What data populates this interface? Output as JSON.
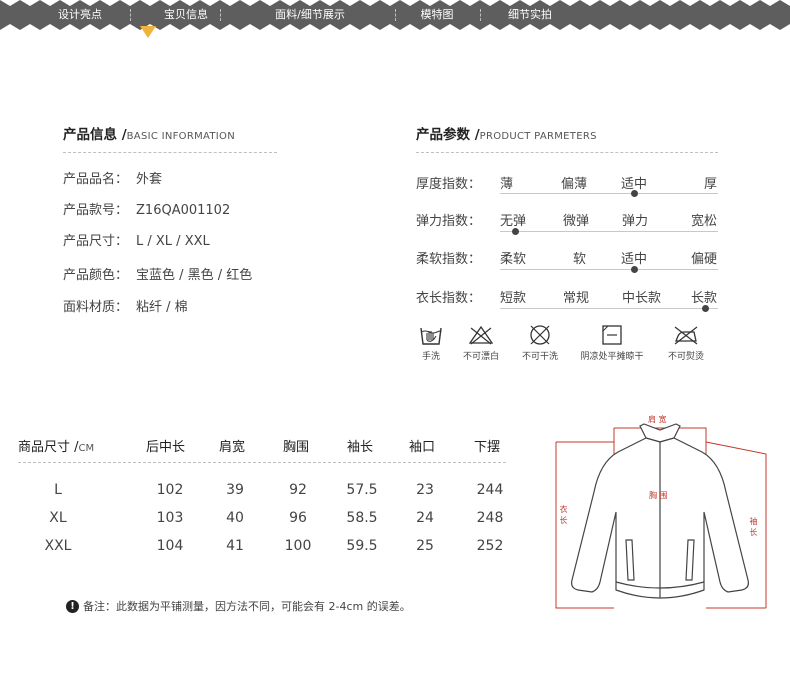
{
  "nav": {
    "items": [
      "设计亮点",
      "宝贝信息",
      "面料/细节展示",
      "模特图",
      "细节实拍"
    ],
    "active_index": 1
  },
  "info": {
    "title": "产品信息 /",
    "subtitle": "BASIC INFORMATION",
    "rows": [
      {
        "label": "产品品名：",
        "value": "外套"
      },
      {
        "label": "产品款号：",
        "value": "Z16QA001102"
      },
      {
        "label": "产品尺寸：",
        "value": "L / XL / XXL"
      },
      {
        "label": "产品颜色：",
        "value": "宝蓝色 / 黑色 / 红色"
      },
      {
        "label": "面料材质：",
        "value": "粘纤 / 棉"
      }
    ]
  },
  "params": {
    "title": "产品参数 /",
    "subtitle": "PRODUCT PARMETERS",
    "rows": [
      {
        "label": "厚度指数：",
        "options": [
          "薄",
          "偏薄",
          "适中",
          "厚"
        ],
        "selected_index": 2
      },
      {
        "label": "弹力指数：",
        "options": [
          "无弹",
          "微弹",
          "弹力",
          "宽松"
        ],
        "selected_index": 0
      },
      {
        "label": "柔软指数：",
        "options": [
          "柔软",
          "软",
          "适中",
          "偏硬"
        ],
        "selected_index": 2
      },
      {
        "label": "衣长指数：",
        "options": [
          "短款",
          "常规",
          "中长款",
          "长款"
        ],
        "selected_index": 3
      }
    ]
  },
  "care": [
    {
      "icon": "hand-wash-icon",
      "label": "手洗"
    },
    {
      "icon": "no-bleach-icon",
      "label": "不可漂白"
    },
    {
      "icon": "no-dry-clean-icon",
      "label": "不可干洗"
    },
    {
      "icon": "shade-dry-flat-icon",
      "label": "阴凉处平摊晾干"
    },
    {
      "icon": "no-iron-icon",
      "label": "不可熨烫"
    }
  ],
  "size_table": {
    "header_label": "商品尺寸 /",
    "header_unit": "CM",
    "columns": [
      "后中长",
      "肩宽",
      "胸围",
      "袖长",
      "袖口",
      "下摆"
    ],
    "rows": [
      {
        "size": "L",
        "values": [
          "102",
          "39",
          "92",
          "57.5",
          "23",
          "244"
        ]
      },
      {
        "size": "XL",
        "values": [
          "103",
          "40",
          "96",
          "58.5",
          "24",
          "248"
        ]
      },
      {
        "size": "XXL",
        "values": [
          "104",
          "41",
          "100",
          "59.5",
          "25",
          "252"
        ]
      }
    ]
  },
  "note": {
    "icon": "warning-icon",
    "text": "备注：此数据为平铺测量，因方法不同，可能会有 2-4cm 的误差。"
  },
  "diagram": {
    "shoulder": "肩 宽",
    "chest": "胸 围",
    "length": "衣长",
    "sleeve": "袖长"
  },
  "colors": {
    "nav_bg": "#5e5e5e",
    "nav_pointer": "#f0b43c",
    "measure_line": "#c0392b"
  }
}
